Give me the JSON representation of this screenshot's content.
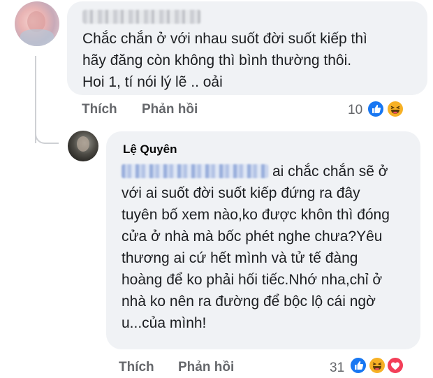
{
  "comments": [
    {
      "author": "",
      "text": "Chắc chắn ở với nhau suốt đời suốt kiếp thì hãy đăng còn không thì bình thường thôi. Hoi 1, tí nói lý lẽ .. oải",
      "actions": {
        "like_label": "Thích",
        "reply_label": "Phản hồi"
      },
      "reaction_count": "10",
      "reactions": [
        "like-icon",
        "haha-icon"
      ]
    },
    {
      "author": "Lệ Quyên",
      "text": "ai chắc chắn sẽ ở với ai suốt đời suốt kiếp đứng ra đây tuyên bố xem nào,ko được khôn thì đóng cửa ở nhà mà bốc phét nghe chưa?Yêu thương ai cứ hết mình và tử tế đàng hoàng để ko phải hối tiếc.Nhớ nha,chỉ ở nhà ko nên ra đường để bộc lộ cái ngờ u...của mình!",
      "actions": {
        "like_label": "Thích",
        "reply_label": "Phản hồi"
      },
      "reaction_count": "31",
      "reactions": [
        "like-icon",
        "haha-icon",
        "love-icon"
      ]
    }
  ],
  "colors": {
    "bubble": "#f0f2f5",
    "text": "#1c1e21",
    "muted": "#65676b",
    "like": "#1877f2",
    "haha": "#f7b125",
    "love": "#f33e58"
  }
}
